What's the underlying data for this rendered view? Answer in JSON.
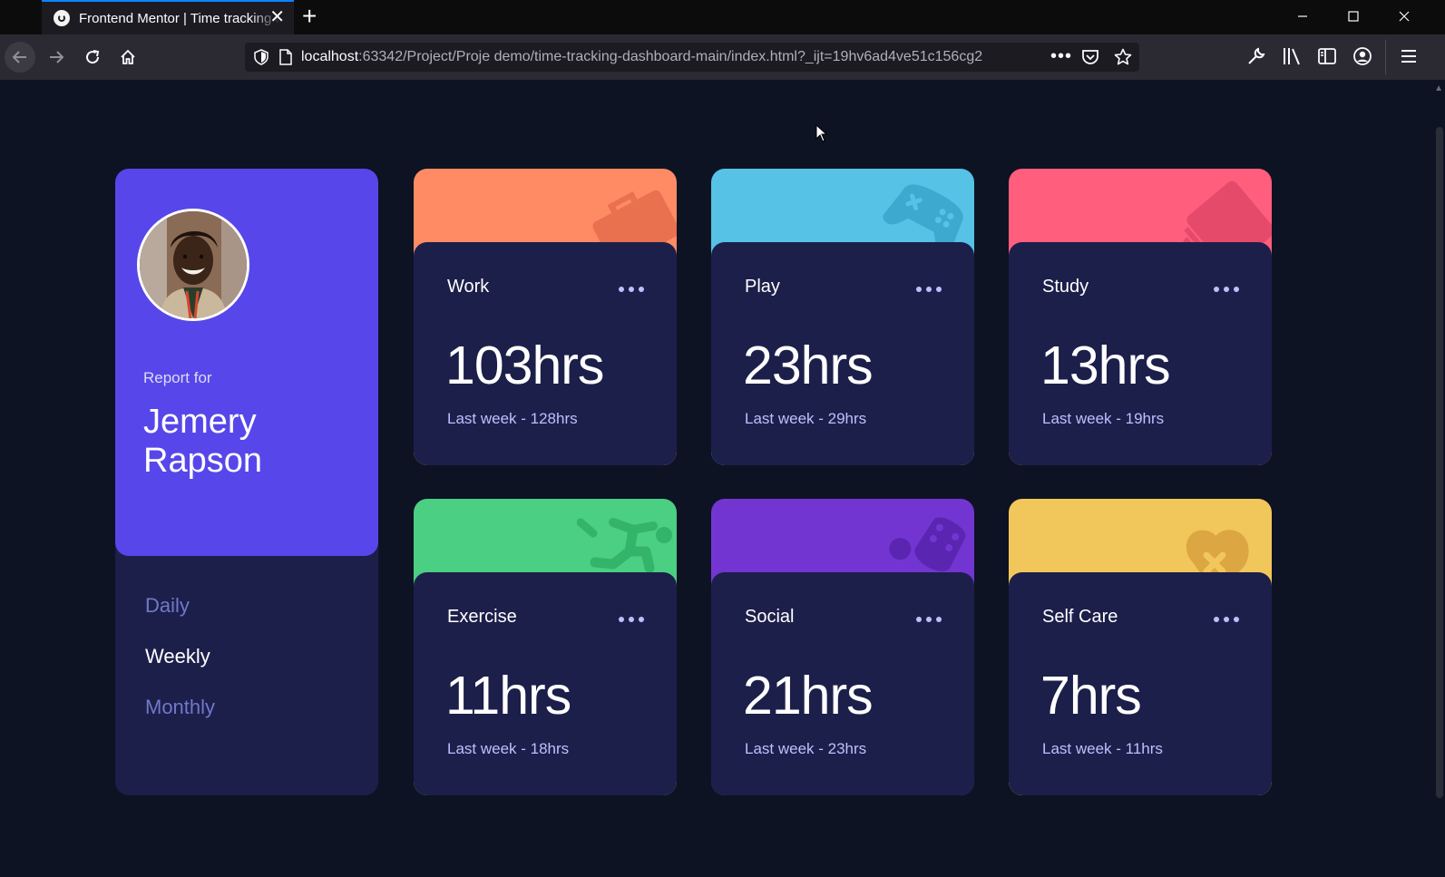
{
  "browser": {
    "tab_title": "Frontend Mentor | Time tracking dashboard",
    "url_host": "localhost",
    "url_rest": ":63342/Project/Proje demo/time-tracking-dashboard-main/index.html?_ijt=19hv6ad4ve51c156cg2",
    "new_tab": "+",
    "tab_close": "✕",
    "url_more": "•••"
  },
  "profile": {
    "report_for": "Report for",
    "name": "Jemery Rapson",
    "periods": [
      "Daily",
      "Weekly",
      "Monthly"
    ],
    "active_period": "Weekly"
  },
  "cards": [
    {
      "title": "Work",
      "current": "103hrs",
      "previous": "Last week - 128hrs",
      "color": "#ff8b64",
      "icon": "work-icon"
    },
    {
      "title": "Play",
      "current": "23hrs",
      "previous": "Last week - 29hrs",
      "color": "#55c2e6",
      "icon": "play-icon"
    },
    {
      "title": "Study",
      "current": "13hrs",
      "previous": "Last week - 19hrs",
      "color": "#ff5e7d",
      "icon": "study-icon"
    },
    {
      "title": "Exercise",
      "current": "11hrs",
      "previous": "Last week - 18hrs",
      "color": "#4bcf82",
      "icon": "exercise-icon"
    },
    {
      "title": "Social",
      "current": "21hrs",
      "previous": "Last week - 23hrs",
      "color": "#7335d2",
      "icon": "social-icon"
    },
    {
      "title": "Self Care",
      "current": "7hrs",
      "previous": "Last week - 11hrs",
      "color": "#f1c75b",
      "icon": "self-care-icon"
    }
  ],
  "colors": {
    "page_bg": "#0d1323",
    "card_bg": "#1c1f4a",
    "profile_accent": "#5747ea",
    "muted_text": "#bbc0ff",
    "period_inactive": "#7078c9"
  }
}
